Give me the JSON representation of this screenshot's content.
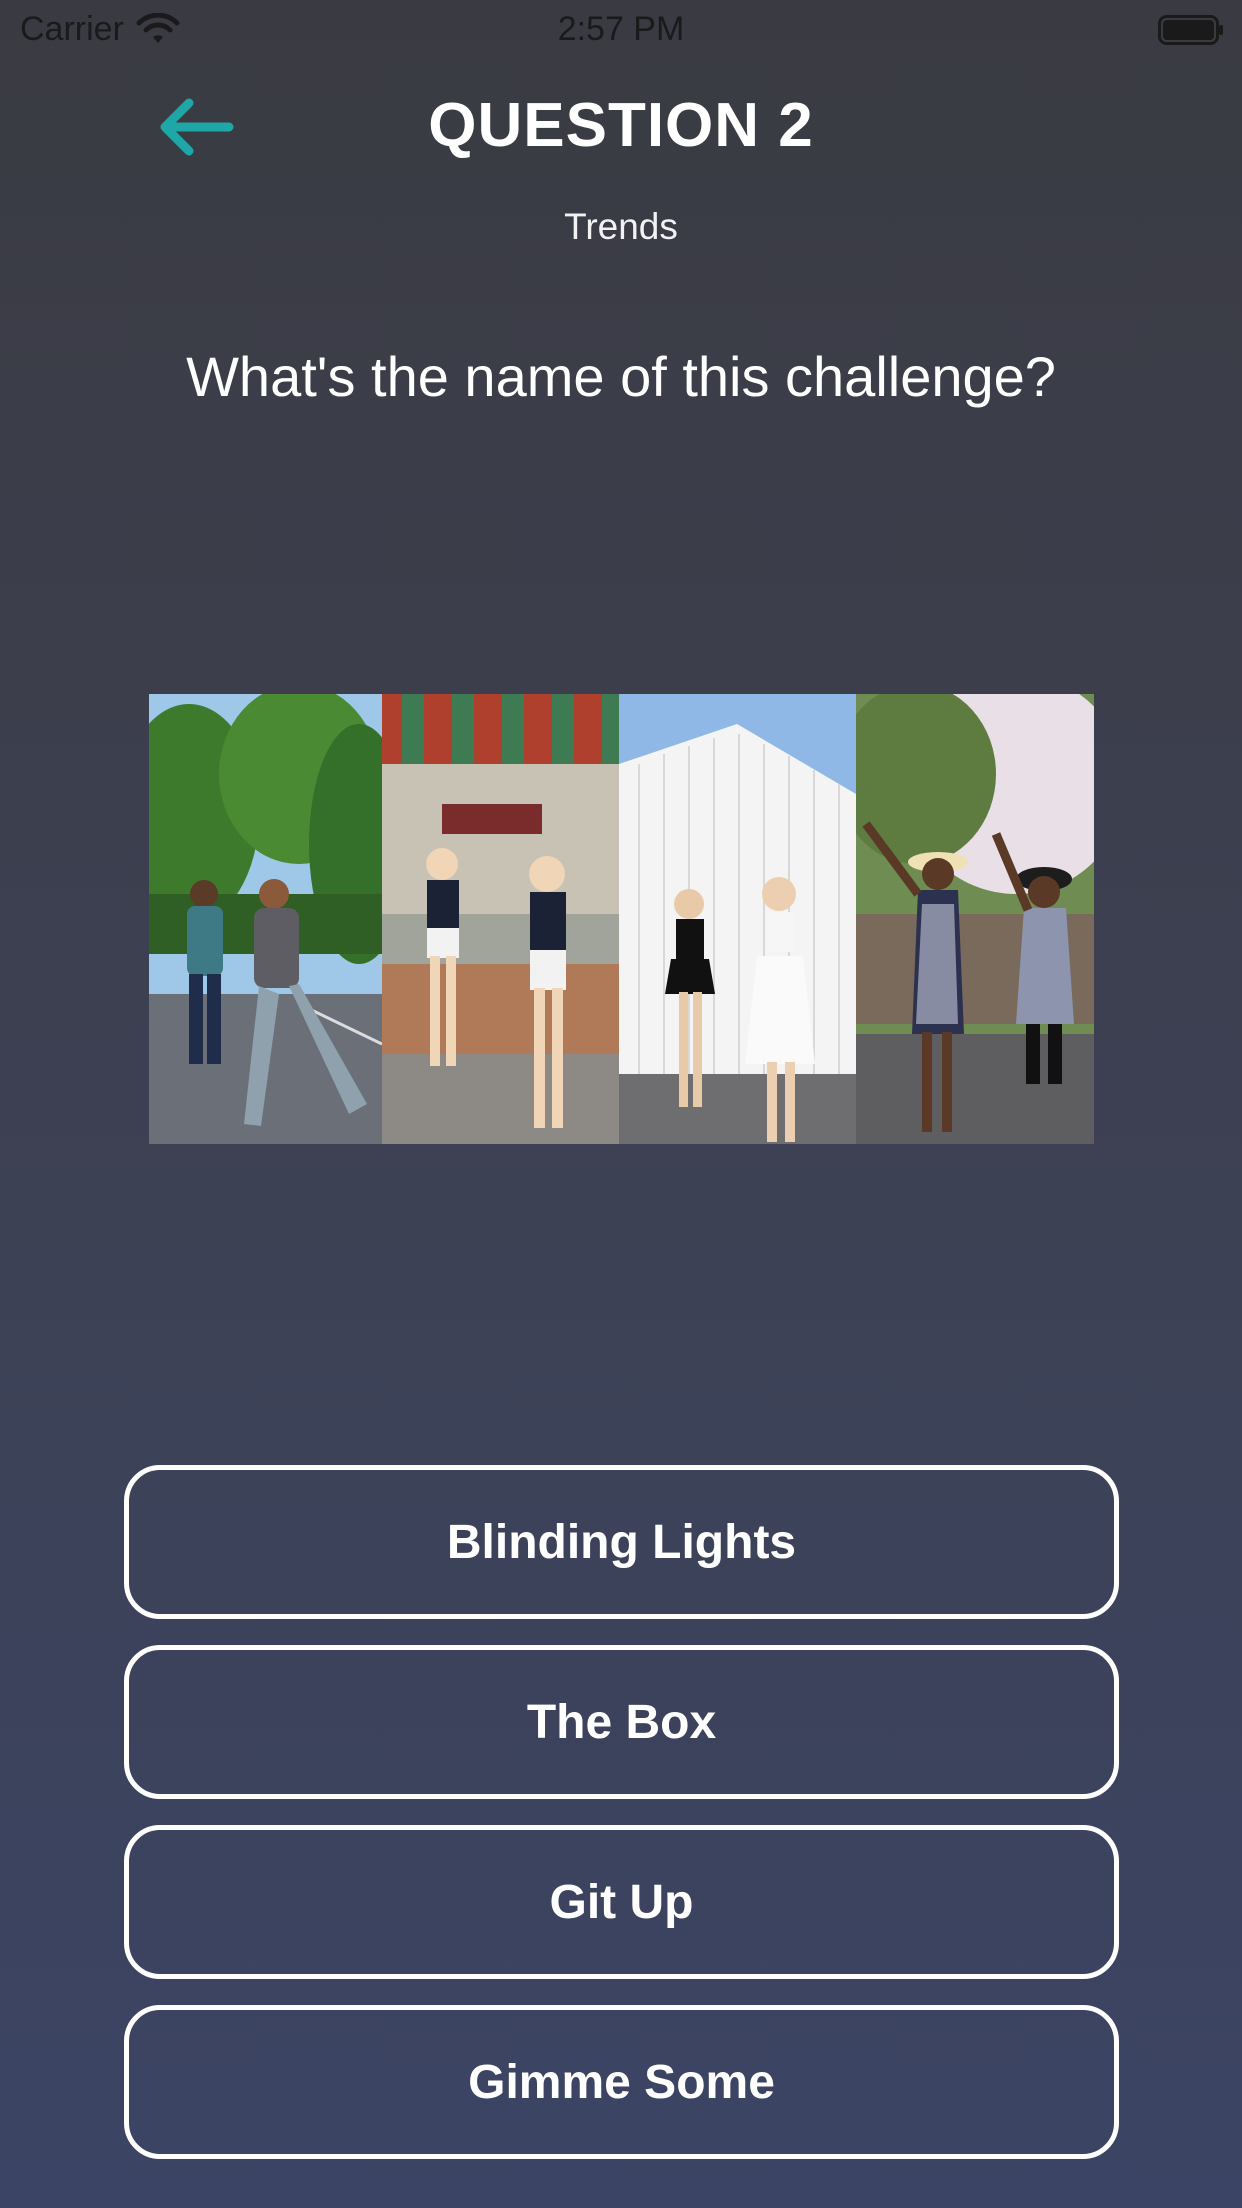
{
  "status_bar": {
    "carrier": "Carrier",
    "time": "2:57 PM",
    "icons": [
      "wifi-icon",
      "battery-icon"
    ]
  },
  "header": {
    "back_icon": "arrow-left-icon",
    "title": "QUESTION 2",
    "category": "Trends"
  },
  "question": {
    "text": "What's the name of this challenge?",
    "image_panels": 4
  },
  "answers": [
    {
      "label": "Blinding Lights"
    },
    {
      "label": "The Box"
    },
    {
      "label": "Git Up"
    },
    {
      "label": "Gimme Some"
    }
  ],
  "colors": {
    "accent": "#1fa6a6",
    "background_top": "#3a3b42",
    "background_bottom": "#3b4464",
    "button_border": "#ffffff"
  }
}
